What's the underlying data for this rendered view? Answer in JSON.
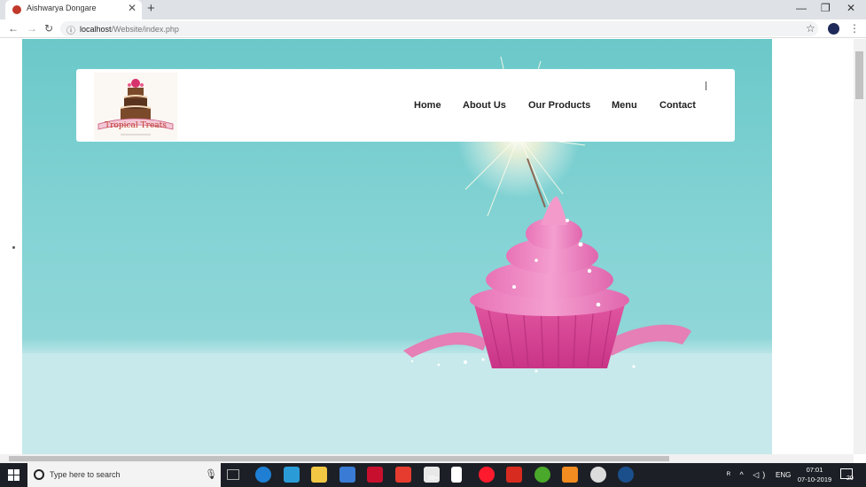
{
  "browser": {
    "tab_title": "Aishwarya Dongare",
    "tab_close": "✕",
    "new_tab": "+",
    "window_minimize": "—",
    "window_restore": "❐",
    "window_close": "✕",
    "back": "←",
    "forward": "→",
    "reload": "↻",
    "info_icon": "ⓘ",
    "url_host": "localhost",
    "url_path": "/Website/index.php",
    "bookmark_icon": "☆",
    "menu_icon": "⋮"
  },
  "site": {
    "logo_name": "Tropical Treats",
    "nav": [
      "Home",
      "About Us",
      "Our Products",
      "Menu",
      "Contact"
    ]
  },
  "taskbar": {
    "search_placeholder": "Type here to search",
    "mic_icon": "🎙",
    "badge_count": "99+",
    "tray_glyphs": "ᴿ  ^  ◁)  ",
    "language": "ENG",
    "time": "07:01",
    "date": "07-10-2019",
    "notification_count": "20"
  },
  "colors": {
    "hero_teal": "#84d3d4",
    "frosting_pink": "#ec7bbf",
    "taskbar": "#1c1f26"
  }
}
